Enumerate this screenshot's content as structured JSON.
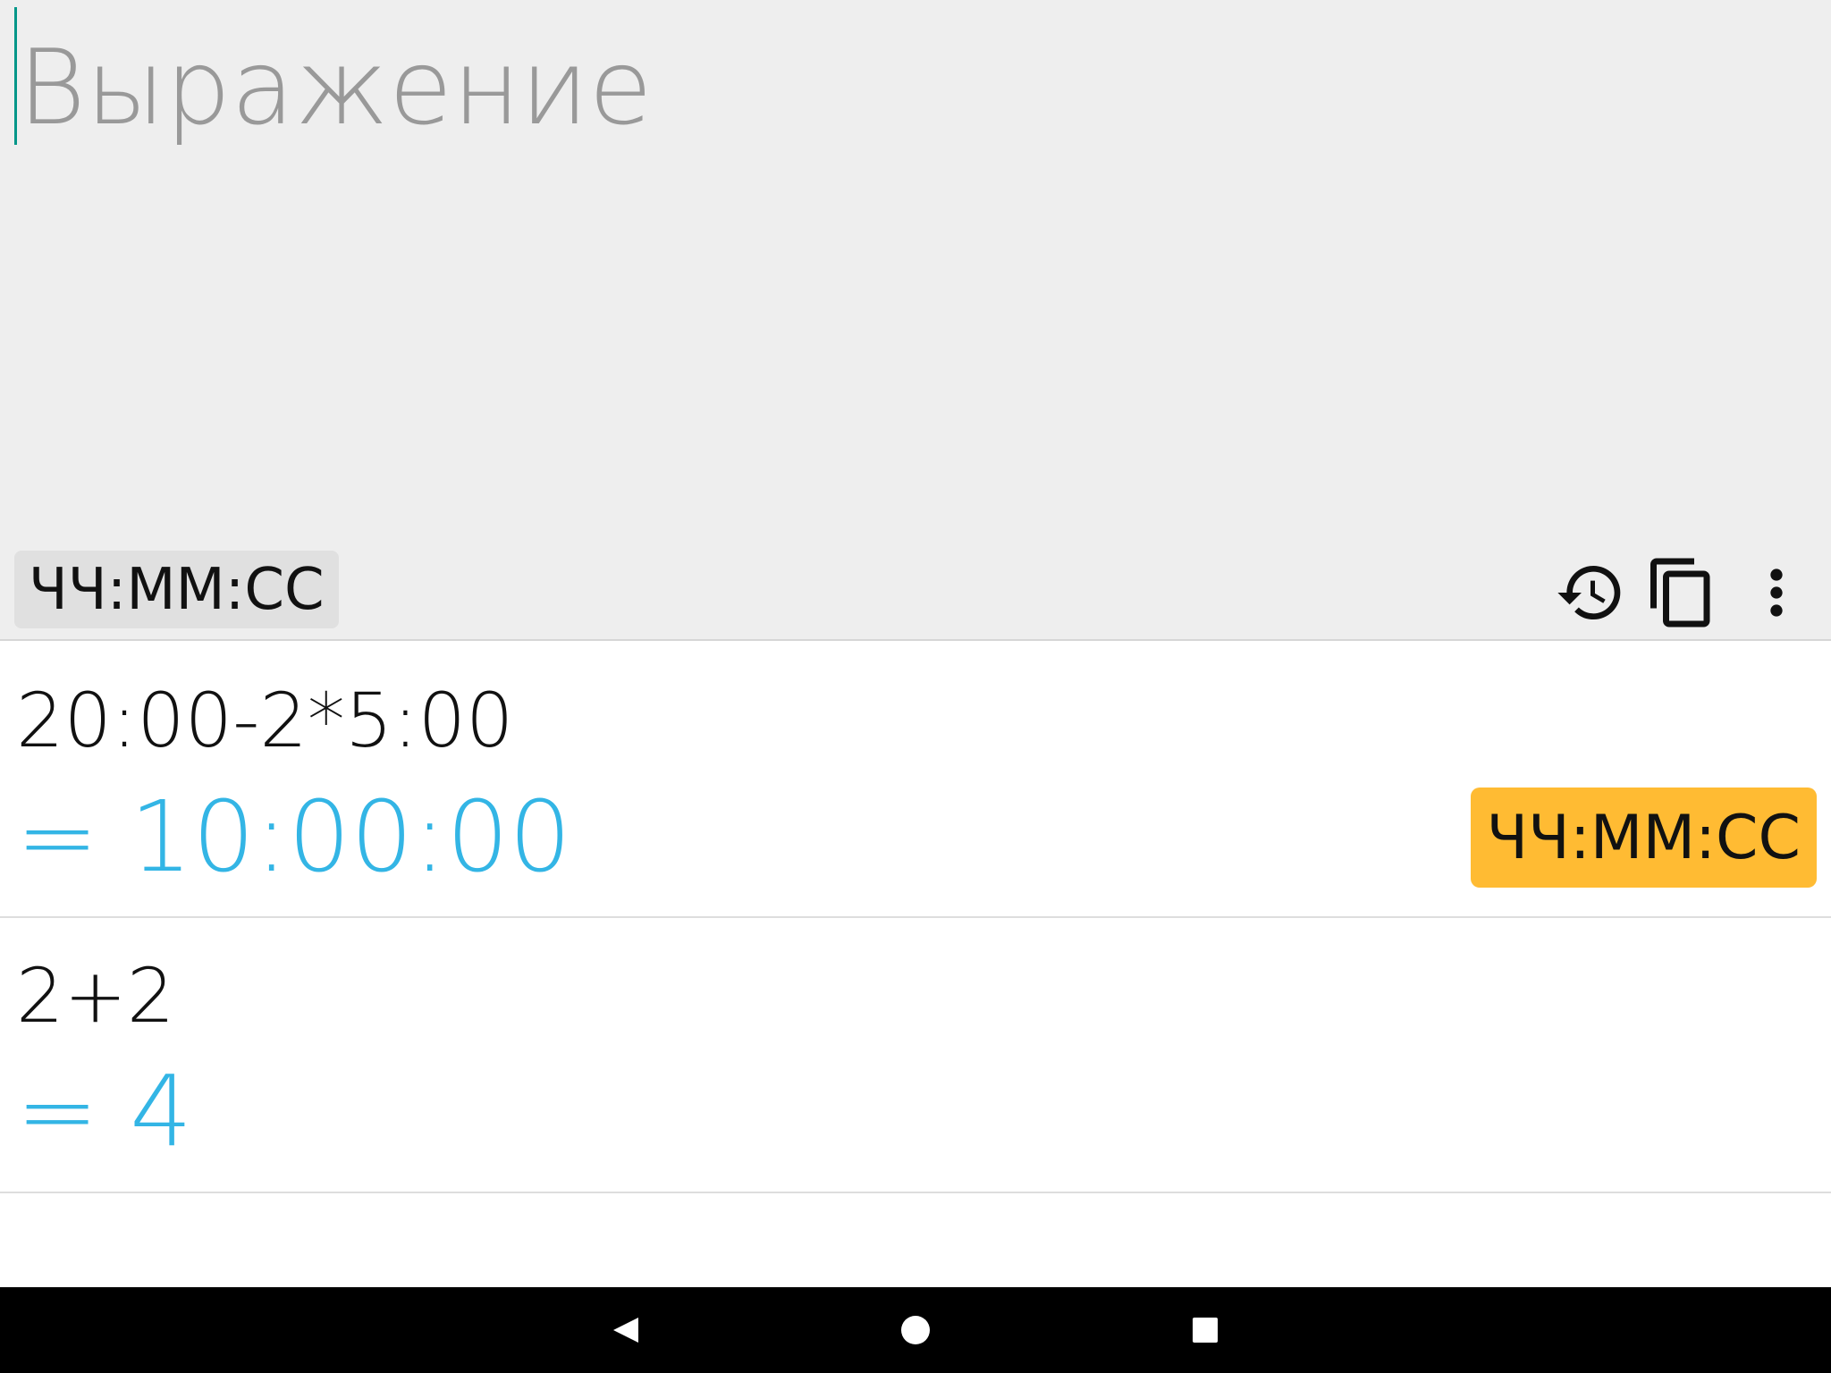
{
  "input": {
    "value": "",
    "placeholder": "Выражение",
    "format_label": "ЧЧ:ММ:СС"
  },
  "toolbar": {
    "icons": [
      "history-icon",
      "copy-icon",
      "more-vert-icon"
    ]
  },
  "history": [
    {
      "expression": "20:00-2*5:00",
      "result": "= 10:00:00",
      "format_label": "ЧЧ:ММ:СС"
    },
    {
      "expression": "2+2",
      "result": "= 4"
    }
  ],
  "colors": {
    "accent": "#33b5e5",
    "chip_active": "#ffbb33",
    "cursor": "#009688",
    "panel_bg": "#eeeeee"
  },
  "navbar": {
    "icons": [
      "back-icon",
      "home-icon",
      "recents-icon"
    ]
  }
}
